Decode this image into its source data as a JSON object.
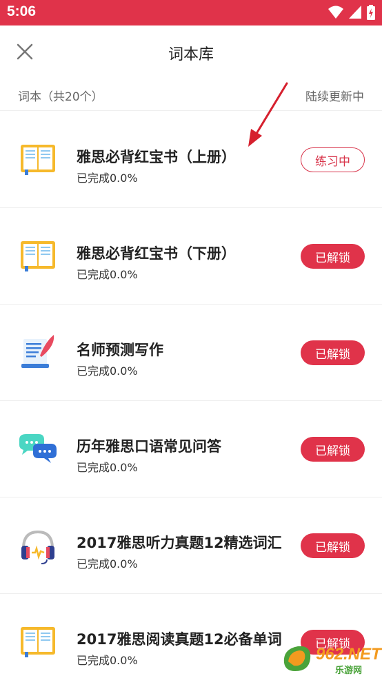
{
  "status_bar": {
    "time": "5:06"
  },
  "header": {
    "title": "词本库"
  },
  "subheader": {
    "count_label": "词本（共20个）",
    "update_label": "陆续更新中"
  },
  "books": [
    {
      "name": "雅思必背红宝书（上册）",
      "progress": "已完成0.0%",
      "action": "练习中",
      "state": "practice",
      "icon": "book-icon"
    },
    {
      "name": "雅思必背红宝书（下册）",
      "progress": "已完成0.0%",
      "action": "已解锁",
      "state": "unlocked",
      "icon": "book-icon"
    },
    {
      "name": "名师预测写作",
      "progress": "已完成0.0%",
      "action": "已解锁",
      "state": "unlocked",
      "icon": "writing-quill-icon"
    },
    {
      "name": "历年雅思口语常见问答",
      "progress": "已完成0.0%",
      "action": "已解锁",
      "state": "unlocked",
      "icon": "chat-bubbles-icon"
    },
    {
      "name": "2017雅思听力真题12精选词汇",
      "progress": "已完成0.0%",
      "action": "已解锁",
      "state": "unlocked",
      "icon": "headphones-icon"
    },
    {
      "name": "2017雅思阅读真题12必备单词",
      "progress": "已完成0.0%",
      "action": "已解锁",
      "state": "unlocked",
      "icon": "book-icon"
    }
  ],
  "watermark": {
    "brand": "962.NET",
    "sub": "乐游网"
  },
  "colors": {
    "accent": "#e0334a",
    "divider": "#eeeeee"
  }
}
